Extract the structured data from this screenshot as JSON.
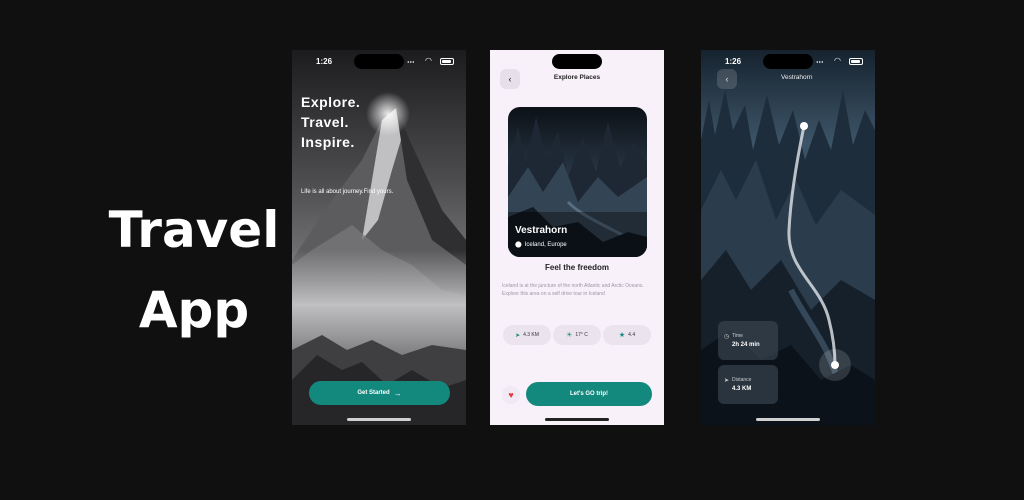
{
  "hero": {
    "line1": "Travel",
    "line2": "App"
  },
  "status_time": "1:26",
  "screen1": {
    "headline": [
      "Explore.",
      "Travel.",
      "Inspire."
    ],
    "subtitle": "Life is all about journey.Find yours.",
    "cta": "Get Started",
    "cta_icon": "arrow-right-icon"
  },
  "screen2": {
    "title": "Explore Places",
    "place_name": "Vestrahorn",
    "place_location": "Iceland, Europe",
    "tagline": "Feel the freedom",
    "description": "Iceland is at the juncture of the north Atlantic and Arctic Oceans. Explore this area on a self drive tour in Iceland",
    "chips": [
      {
        "icon": "navigation-icon",
        "label": "4.3 KM"
      },
      {
        "icon": "sun-icon",
        "label": "17° C"
      },
      {
        "icon": "star-icon",
        "label": "4.4"
      }
    ],
    "cta": "Let's GO trip!"
  },
  "screen3": {
    "title": "Vestrahorn",
    "time_label": "Time",
    "time_value": "2h 24 min",
    "distance_label": "Distance",
    "distance_value": "4.3 KM"
  },
  "colors": {
    "accent": "#13897e",
    "background": "#111010",
    "screen2_bg": "#f8f1fa",
    "heart": "#e23b3b"
  }
}
